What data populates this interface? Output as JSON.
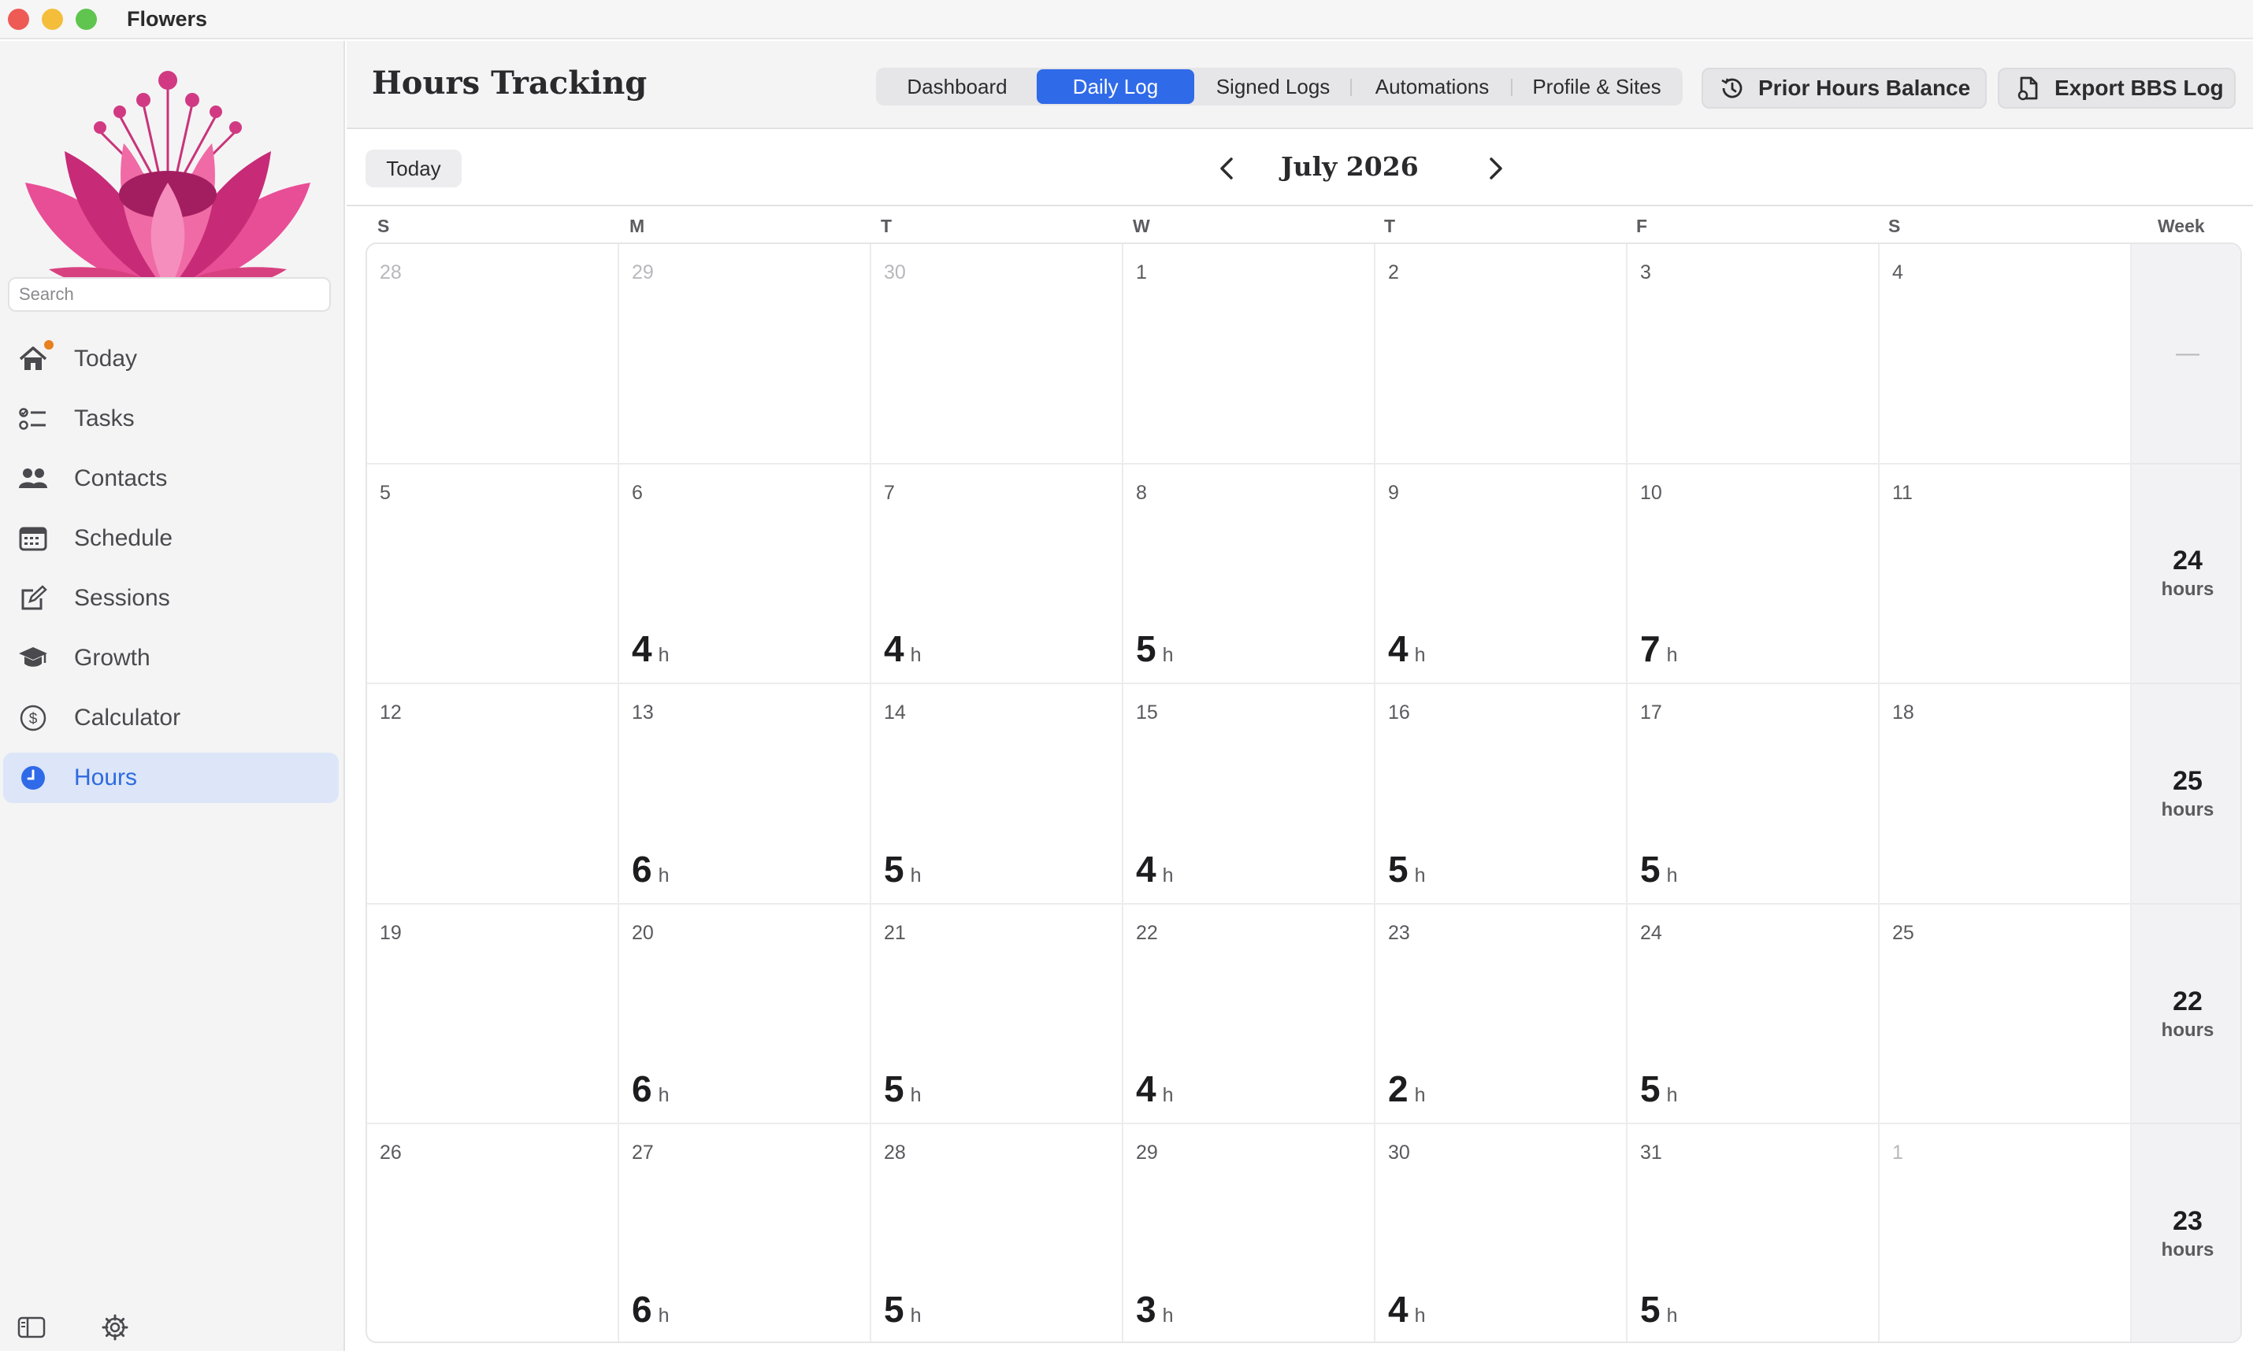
{
  "window": {
    "title": "Flowers"
  },
  "colors": {
    "accent": "#2f6ae8",
    "sidebar_active_bg": "#dce6f8",
    "badge": "#e8801e"
  },
  "sidebar": {
    "search_placeholder": "Search",
    "items": [
      {
        "label": "Today",
        "icon": "house-icon",
        "badge": true
      },
      {
        "label": "Tasks",
        "icon": "checklist-icon"
      },
      {
        "label": "Contacts",
        "icon": "people-icon"
      },
      {
        "label": "Schedule",
        "icon": "calendar-icon"
      },
      {
        "label": "Sessions",
        "icon": "compose-icon"
      },
      {
        "label": "Growth",
        "icon": "graduation-cap-icon"
      },
      {
        "label": "Calculator",
        "icon": "dollar-circle-icon"
      },
      {
        "label": "Hours",
        "icon": "clock-icon",
        "active": true
      }
    ],
    "footer_icons": [
      "sidebar-toggle-icon",
      "gear-icon"
    ]
  },
  "header": {
    "title": "Hours Tracking",
    "tabs": [
      {
        "label": "Dashboard"
      },
      {
        "label": "Daily Log",
        "active": true
      },
      {
        "label": "Signed Logs"
      },
      {
        "label": "Automations"
      },
      {
        "label": "Profile & Sites"
      }
    ],
    "prior_hours_label": "Prior Hours Balance",
    "export_label": "Export BBS Log"
  },
  "calendar": {
    "today_label": "Today",
    "month_title": "July 2026",
    "weekdays": [
      "S",
      "M",
      "T",
      "W",
      "T",
      "F",
      "S"
    ],
    "week_header": "Week",
    "hours_unit": "h",
    "week_unit": "hours",
    "weeks": [
      {
        "total": "—",
        "days": [
          {
            "day": "28",
            "dim": true,
            "hours": ""
          },
          {
            "day": "29",
            "dim": true,
            "hours": ""
          },
          {
            "day": "30",
            "dim": true,
            "hours": ""
          },
          {
            "day": "1",
            "hours": ""
          },
          {
            "day": "2",
            "hours": ""
          },
          {
            "day": "3",
            "hours": ""
          },
          {
            "day": "4",
            "hours": ""
          }
        ]
      },
      {
        "total": "24",
        "days": [
          {
            "day": "5",
            "hours": ""
          },
          {
            "day": "6",
            "hours": "4"
          },
          {
            "day": "7",
            "hours": "4"
          },
          {
            "day": "8",
            "hours": "5"
          },
          {
            "day": "9",
            "hours": "4"
          },
          {
            "day": "10",
            "hours": "7"
          },
          {
            "day": "11",
            "hours": ""
          }
        ]
      },
      {
        "total": "25",
        "days": [
          {
            "day": "12",
            "hours": ""
          },
          {
            "day": "13",
            "hours": "6"
          },
          {
            "day": "14",
            "hours": "5"
          },
          {
            "day": "15",
            "hours": "4"
          },
          {
            "day": "16",
            "hours": "5"
          },
          {
            "day": "17",
            "hours": "5"
          },
          {
            "day": "18",
            "hours": ""
          }
        ]
      },
      {
        "total": "22",
        "days": [
          {
            "day": "19",
            "hours": ""
          },
          {
            "day": "20",
            "hours": "6"
          },
          {
            "day": "21",
            "hours": "5"
          },
          {
            "day": "22",
            "hours": "4"
          },
          {
            "day": "23",
            "hours": "2"
          },
          {
            "day": "24",
            "hours": "5"
          },
          {
            "day": "25",
            "hours": ""
          }
        ]
      },
      {
        "total": "23",
        "days": [
          {
            "day": "26",
            "hours": ""
          },
          {
            "day": "27",
            "hours": "6"
          },
          {
            "day": "28",
            "hours": "5"
          },
          {
            "day": "29",
            "hours": "3"
          },
          {
            "day": "30",
            "hours": "4"
          },
          {
            "day": "31",
            "hours": "5"
          },
          {
            "day": "1",
            "dim": true,
            "hours": ""
          }
        ]
      }
    ]
  }
}
